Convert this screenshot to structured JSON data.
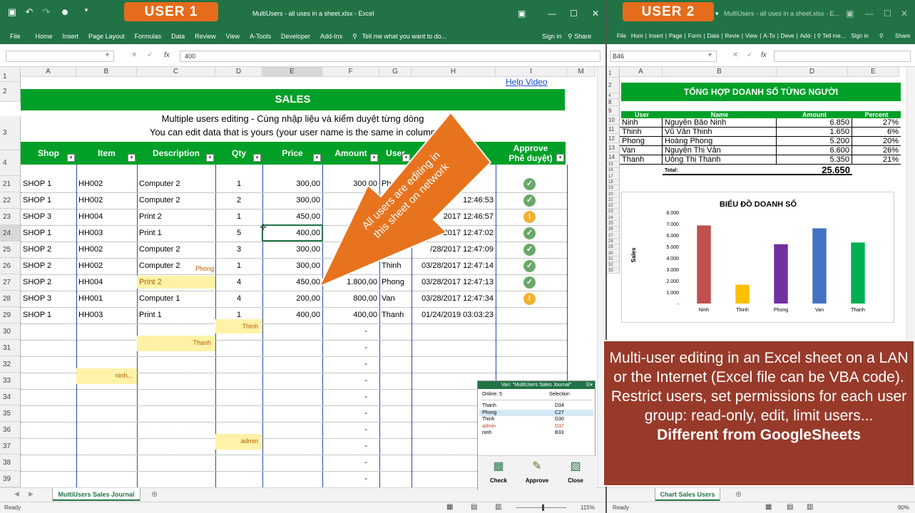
{
  "window1": {
    "user_badge": "USER 1",
    "title": "MultiUsers - all uses in a sheet.xlsx - Excel",
    "ribbon_tabs": [
      "File",
      "Home",
      "Insert",
      "Page Layout",
      "Formulas",
      "Data",
      "Review",
      "View",
      "A-Tools",
      "Developer",
      "Add-Ins"
    ],
    "tell_me": "Tell me what you want to do...",
    "sign_in": "Sign in",
    "share": "Share",
    "formula_value": "400",
    "columns": [
      "A",
      "B",
      "C",
      "D",
      "E",
      "F",
      "G",
      "H",
      "I",
      "M"
    ],
    "help_link": "Help Video",
    "sales_title": "SALES",
    "subtitle_line1": "Multiple users editing - Cùng nhập liệu và kiểm duyệt từng dòng",
    "subtitle_line2": "You can edit data that is yours (your user name is the same in column",
    "headers": [
      "Shop",
      "Item",
      "Description",
      "Qty",
      "Price",
      "Amount",
      "User",
      "",
      "Approve (Phê duyệt)"
    ],
    "approve_short": "Phê duyệt)",
    "rows": [
      {
        "row": "21",
        "shop": "SHOP 1",
        "item": "HH002",
        "desc": "Computer 2",
        "qty": "1",
        "price": "300,00",
        "amount": "300,00",
        "user": "Phong",
        "time": "",
        "approve": "check"
      },
      {
        "row": "22",
        "shop": "SHOP 1",
        "item": "HH002",
        "desc": "Computer 2",
        "qty": "2",
        "price": "300,00",
        "amount": "600",
        "user": "",
        "time": "12:46:53",
        "approve": "check"
      },
      {
        "row": "23",
        "shop": "SHOP 3",
        "item": "HH004",
        "desc": "Print 2",
        "qty": "1",
        "price": "450,00",
        "amount": "4",
        "user": "",
        "time": "2017 12:46:57",
        "approve": "warn"
      },
      {
        "row": "24",
        "shop": "SHOP 1",
        "item": "HH003",
        "desc": "Print 1",
        "qty": "5",
        "price": "400,00",
        "amount": "",
        "user": "",
        "time": "3/28/2017 12:47:02",
        "approve": "check"
      },
      {
        "row": "25",
        "shop": "SHOP 2",
        "item": "HH002",
        "desc": "Computer 2",
        "qty": "3",
        "price": "300,00",
        "amount": "",
        "user": "",
        "time": "/28/2017 12:47:09",
        "approve": "check"
      },
      {
        "row": "26",
        "shop": "SHOP 2",
        "item": "HH002",
        "desc": "Computer 2",
        "qty": "1",
        "price": "300,00",
        "amount": "",
        "user": "Thinh",
        "time": "03/28/2017 12:47:14",
        "approve": "check"
      },
      {
        "row": "27",
        "shop": "SHOP 2",
        "item": "HH004",
        "desc": "Print 2",
        "qty": "4",
        "price": "450,00",
        "amount": "1.800,00",
        "user": "Phong",
        "time": "03/28/2017 12:47:13",
        "approve": "check"
      },
      {
        "row": "28",
        "shop": "SHOP 3",
        "item": "HH001",
        "desc": "Computer 1",
        "qty": "4",
        "price": "200,00",
        "amount": "800,00",
        "user": "Van",
        "time": "03/28/2017 12:47:34",
        "approve": "warn"
      },
      {
        "row": "29",
        "shop": "SHOP 1",
        "item": "HH003",
        "desc": "Print 1",
        "qty": "1",
        "price": "400,00",
        "amount": "400,00",
        "user": "Thanh",
        "time": "01/24/2019 03:03:23",
        "approve": ""
      }
    ],
    "empty_rows": [
      "30",
      "31",
      "32",
      "33",
      "34",
      "35",
      "36",
      "37",
      "38",
      "39"
    ],
    "dash": "-",
    "notes": {
      "c27": "Phong",
      "d30": "Thinh",
      "c31": "Thanh",
      "b33": "ninh...",
      "d37": "admin"
    },
    "arrow_text_1": "All users are editing in",
    "arrow_text_2": "this sheet on network",
    "sheet_tab": "MultiUsers Sales Journal",
    "status": "Ready",
    "zoom": "115%",
    "panel": {
      "title": "Van: \"MultiUsers Sales Journal\"",
      "online": "Online: 5",
      "selection_hdr": "Selection",
      "users": [
        {
          "name": "Thanh",
          "sel": "D34"
        },
        {
          "name": "Phong",
          "sel": "C27"
        },
        {
          "name": "Thinh",
          "sel": "D30"
        },
        {
          "name": "admin",
          "sel": "D37"
        },
        {
          "name": "ninh",
          "sel": "B33"
        }
      ],
      "buttons": [
        "Check",
        "Approve",
        "Close"
      ]
    }
  },
  "window2": {
    "user_badge": "USER 2",
    "title": "MultiUsers - all uses in a sheet.xlsx - E...",
    "ribbon_tabs": [
      "File",
      "Hom",
      "Insert",
      "Page",
      "Form",
      "Data",
      "Revie",
      "View",
      "A-To",
      "Deve",
      "Add-"
    ],
    "tell_me": "Tell me...",
    "sign_in": "Sign in",
    "share": "Share",
    "namebox": "B46",
    "columns": [
      "A",
      "B",
      "D",
      "E"
    ],
    "summary_title": "TỔNG HỢP DOANH SỐ TỪNG NGƯỜI",
    "headers": [
      "User",
      "Name",
      "Amount",
      "Percent"
    ],
    "rows": [
      {
        "row": "9",
        "user": "Ninh",
        "name": "Nguyễn Bảo Ninh",
        "amount": "6.850",
        "pct": "27%"
      },
      {
        "row": "10",
        "user": "Thinh",
        "name": "Vũ Văn Thinh",
        "amount": "1.650",
        "pct": "6%"
      },
      {
        "row": "11",
        "user": "Phong",
        "name": "Hoàng Phong",
        "amount": "5.200",
        "pct": "20%"
      },
      {
        "row": "12",
        "user": "Van",
        "name": "Nguyễn Thị Vân",
        "amount": "6.600",
        "pct": "26%"
      },
      {
        "row": "13",
        "user": "Thanh",
        "name": "Uông Thị Thanh",
        "amount": "5.350",
        "pct": "21%"
      }
    ],
    "total_label": "Total:",
    "total_value": "25.650",
    "sheet_tab": "Chart Sales Users",
    "status": "Ready",
    "zoom": "90%"
  },
  "chart_data": {
    "type": "bar",
    "title": "BIỂU ĐỒ DOANH SỐ",
    "ylabel": "Sales",
    "categories": [
      "Ninh",
      "Thinh",
      "Phong",
      "Van",
      "Thanh"
    ],
    "values": [
      6850,
      1650,
      5200,
      6600,
      5350
    ],
    "colors": [
      "#c0504d",
      "#ffc000",
      "#7030a0",
      "#4472c4",
      "#00b050"
    ],
    "ylim": [
      0,
      8000
    ],
    "yticks": [
      "8.000",
      "7.000",
      "6.000",
      "5.000",
      "4.000",
      "3.000",
      "2.000",
      "1.000",
      "-"
    ]
  },
  "promo": {
    "text": "Multi-user editing in an Excel sheet on a LAN or the Internet (Excel file can be VBA code). Restrict users, set permissions for each user group: read-only, edit, limit users...",
    "bold": "Different from GoogleSheets"
  }
}
